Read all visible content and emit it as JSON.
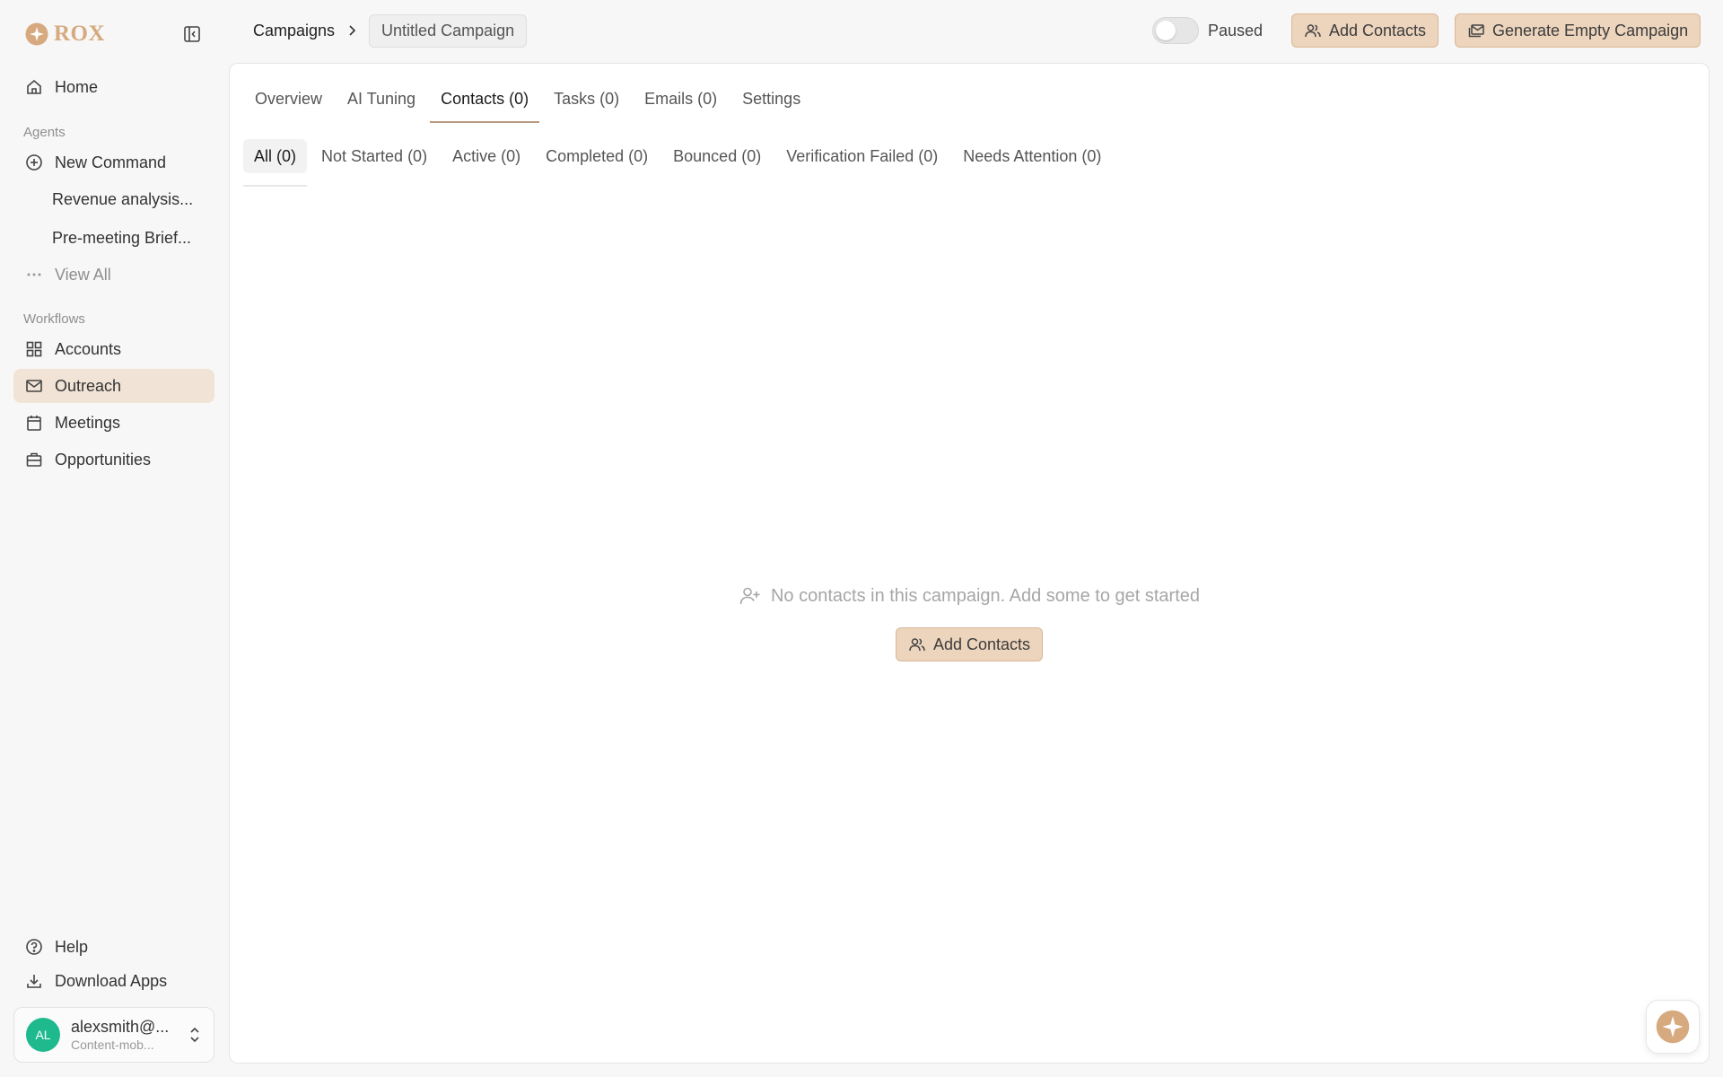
{
  "brand": {
    "name": "ROX",
    "accent": "#d6a97e",
    "active_bg": "#f1e3d6",
    "button_bg": "#ecd4bd"
  },
  "sidebar": {
    "home": "Home",
    "agents_label": "Agents",
    "new_command": "New Command",
    "recent": [
      "Revenue analysis...",
      "Pre-meeting Brief..."
    ],
    "view_all": "View All",
    "workflows_label": "Workflows",
    "workflows": [
      "Accounts",
      "Outreach",
      "Meetings",
      "Opportunities"
    ],
    "active_item": "Outreach",
    "help": "Help",
    "download_apps": "Download Apps",
    "user": {
      "initials": "AL",
      "name": "alexsmith@...",
      "org": "Content-mob..."
    }
  },
  "header": {
    "breadcrumb_root": "Campaigns",
    "breadcrumb_current": "Untitled Campaign",
    "toggle_label": "Paused",
    "toggle_on": false,
    "add_contacts": "Add Contacts",
    "generate": "Generate Empty Campaign"
  },
  "tabs": [
    "Overview",
    "AI Tuning",
    "Contacts (0)",
    "Tasks (0)",
    "Emails (0)",
    "Settings"
  ],
  "active_tab": "Contacts (0)",
  "subtabs": [
    "All (0)",
    "Not Started (0)",
    "Active (0)",
    "Completed (0)",
    "Bounced (0)",
    "Verification Failed (0)",
    "Needs Attention (0)"
  ],
  "active_subtab": "All (0)",
  "empty_state": {
    "message": "No contacts in this campaign. Add some to get started",
    "button": "Add Contacts"
  }
}
